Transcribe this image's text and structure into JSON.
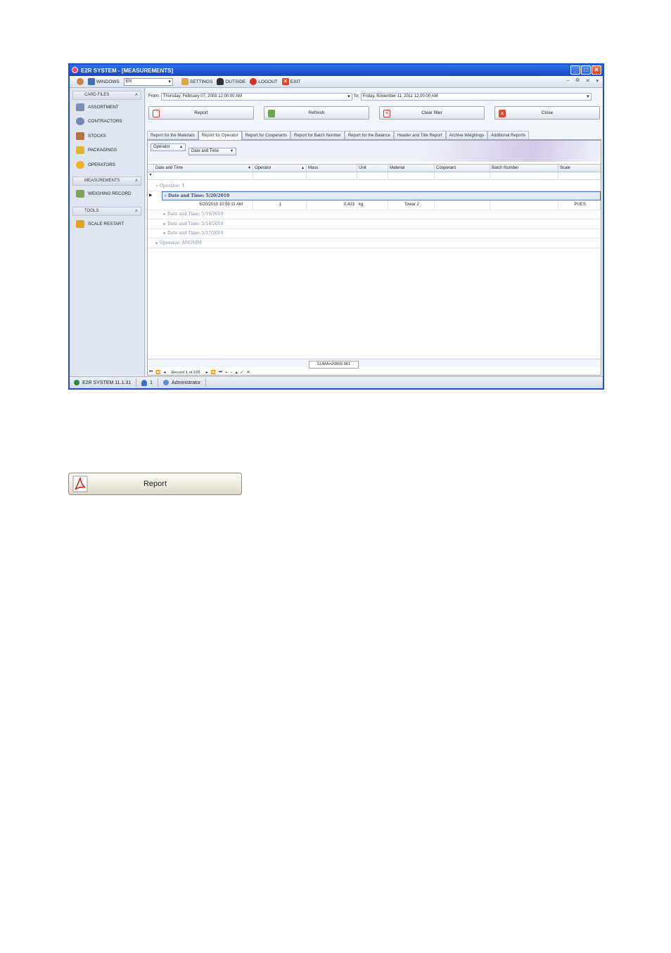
{
  "window": {
    "title": "E2R SYSTEM - [MEASUREMENTS]"
  },
  "toolbar": {
    "windows": "WINDOWS",
    "language": "EN",
    "settings": "SETTINGS",
    "outside": "OUTSIDE",
    "logout": "LOGOUT",
    "exit": "EXIT"
  },
  "sidebar": {
    "groups": [
      {
        "label": "CARD FILES",
        "items": [
          "ASSORTMENT",
          "CONTRACTORS",
          "STOCKS",
          "PACKAGINGS",
          "OPERATORS"
        ]
      },
      {
        "label": "MEASUREMENTS",
        "items": [
          "WEIGHING RECORD"
        ]
      },
      {
        "label": "TOOLS",
        "items": [
          "SCALE RESTART"
        ]
      }
    ]
  },
  "filter": {
    "from_label": "From:",
    "from_value": "Thursday, February 07, 2008 12:00:00 AM",
    "to_label": "To:",
    "to_value": "Friday, November 11, 2011 12:00:00 AM"
  },
  "actions": {
    "report": "Report",
    "refresh": "Refresh",
    "clear_filter": "Clear filter",
    "close": "Close"
  },
  "tabs": [
    "Report for the Materials",
    "Report for Operator",
    "Report for Cooperants",
    "Report for Batch Number",
    "Report for the Balance",
    "Header and Title Report",
    "Archive Weighings",
    "Additional Reports"
  ],
  "grouping": {
    "chip1": "Operator",
    "chip2": "Date and Time"
  },
  "grid": {
    "columns": [
      "Date and Time",
      "Operator",
      "Mass",
      "Unit",
      "Material",
      "Cooperant",
      "Batch Number",
      "Scale"
    ],
    "group1": "Operator: 1",
    "group1_sub": "Date and Time: 5/20/2010",
    "data_row": {
      "datetime": "5/20/2010 10:59:11 AM",
      "operator": "1",
      "mass": "0.413",
      "unit": "kg",
      "material": "Towar 2",
      "cooperant": "",
      "batch": "",
      "scale": "PUES"
    },
    "collapsed": [
      "Date and Time: 5/19/2010",
      "Date and Time: 5/18/2010",
      "Date and Time: 5/17/2010"
    ],
    "group2": "Operator: ANONIM"
  },
  "footer": {
    "sum": "SUMA=20899.961",
    "record": "Record 1 of 226"
  },
  "status": {
    "app": "E2R SYSTEM 11.1.31",
    "users": "1",
    "user": "Administrator"
  },
  "callout": {
    "report": "Report"
  }
}
